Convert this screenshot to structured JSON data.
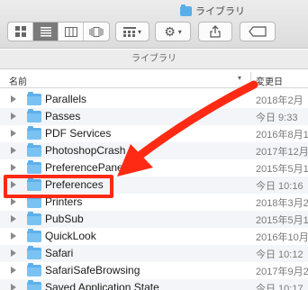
{
  "window": {
    "title": "ライブラリ"
  },
  "path_bar": {
    "label": "ライブラリ"
  },
  "columns": {
    "name": "名前",
    "date": "変更日",
    "sort_indicator": "▾"
  },
  "toolbar": {
    "view_icons": [
      "icon-view-icon",
      "list-view-icon",
      "column-view-icon",
      "coverflow-view-icon"
    ],
    "arrange_label": "▾",
    "action_label": "▾"
  },
  "files": [
    {
      "name": "Parallels",
      "date": "2018年2月"
    },
    {
      "name": "Passes",
      "date": "今日 9:33"
    },
    {
      "name": "PDF Services",
      "date": "2016年8月1"
    },
    {
      "name": "PhotoshopCrash",
      "date": "2017年12月"
    },
    {
      "name": "PreferencePane",
      "date": "2015年5月1"
    },
    {
      "name": "Preferences",
      "date": "今日 10:16"
    },
    {
      "name": "Printers",
      "date": "2018年3月2"
    },
    {
      "name": "PubSub",
      "date": "2015年5月1"
    },
    {
      "name": "QuickLook",
      "date": "2016年10月"
    },
    {
      "name": "Safari",
      "date": "今日 10:12"
    },
    {
      "name": "SafariSafeBrowsing",
      "date": "2017年9月2"
    },
    {
      "name": "Saved Application State",
      "date": "今日 10:17"
    }
  ],
  "annotation": {
    "color": "#ff2a14",
    "highlighted_item": "Preferences"
  },
  "colors": {
    "folder": "#5eb0ea",
    "accent": "#ff2a14"
  }
}
